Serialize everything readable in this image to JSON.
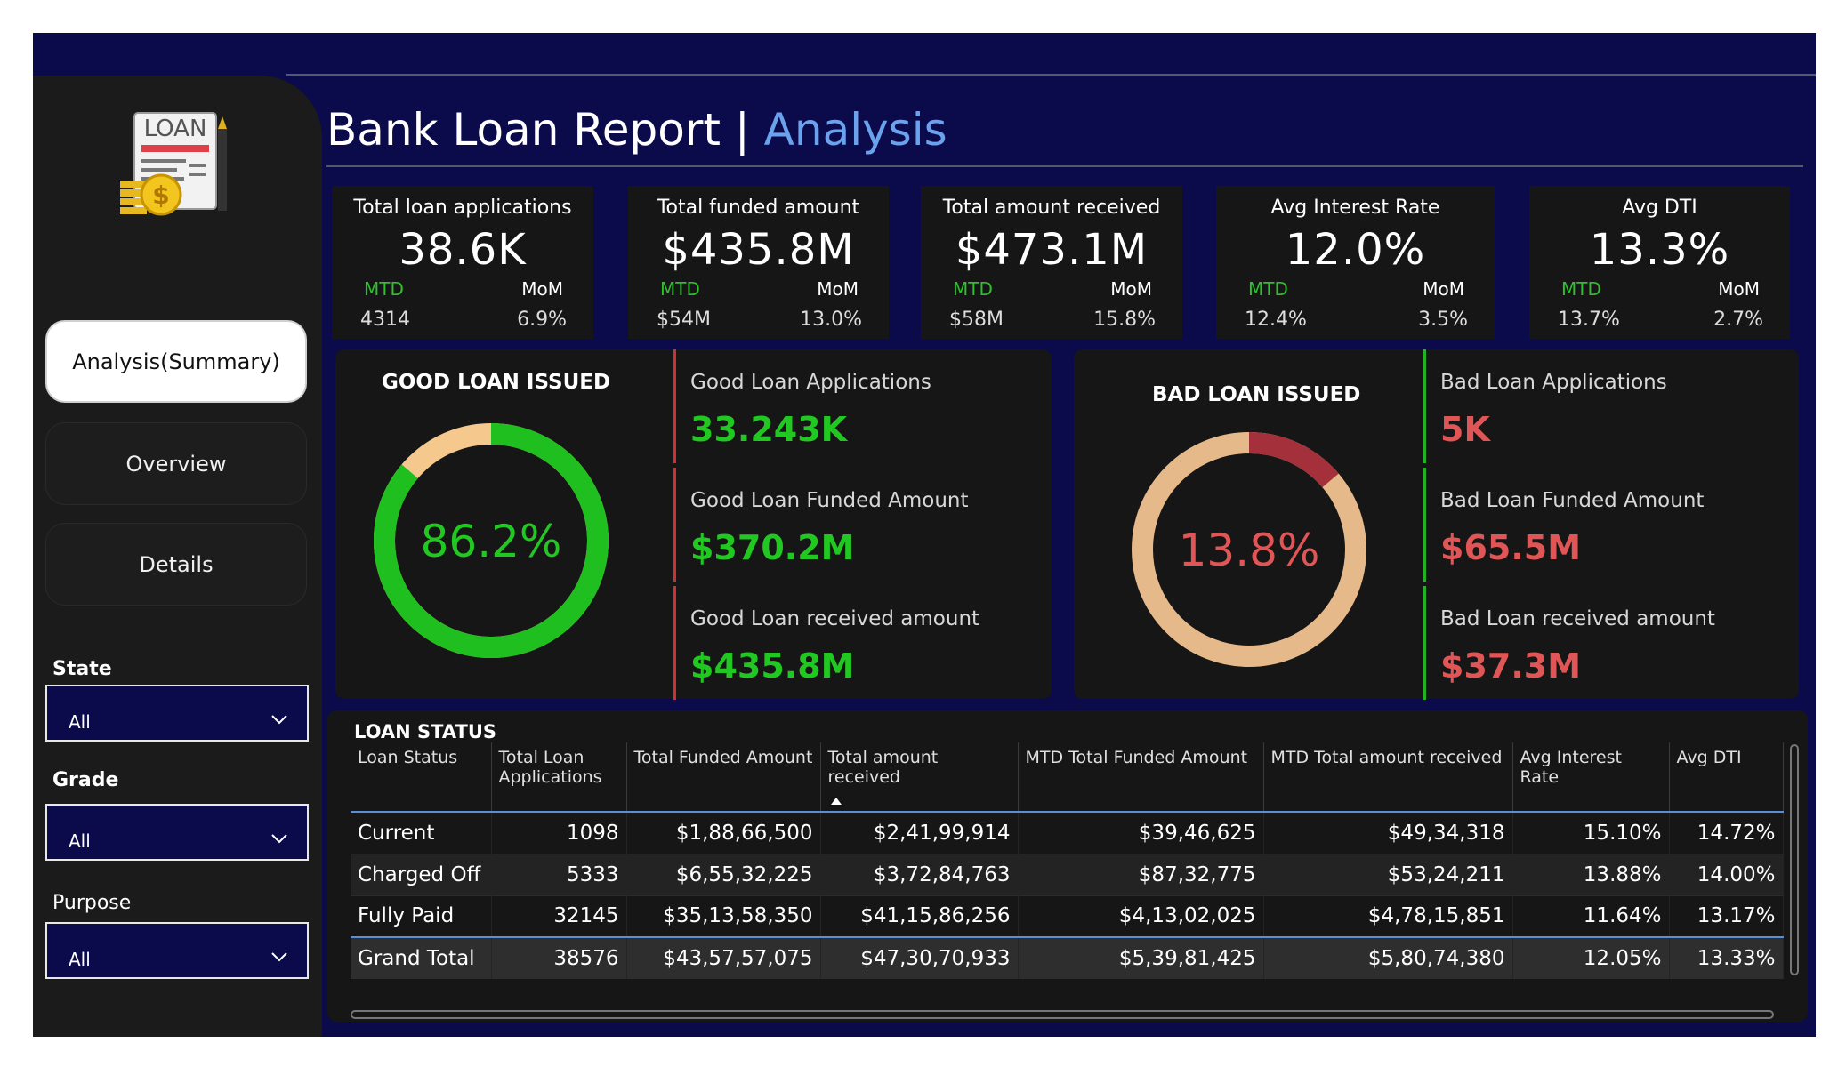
{
  "header": {
    "title_main": "Bank Loan Report",
    "title_sep": " | ",
    "title_accent": "Analysis",
    "logo_text": "LOAN"
  },
  "nav": {
    "summary": "Analysis(Summary)",
    "overview": "Overview",
    "details": "Details"
  },
  "filters": [
    {
      "label": "State",
      "value": "All"
    },
    {
      "label": "Grade",
      "value": "All"
    },
    {
      "label": "Purpose",
      "value": "All"
    }
  ],
  "kpis": [
    {
      "label": "Total loan applications",
      "value": "38.6K",
      "mtd_label": "MTD",
      "mom_label": "MoM",
      "mtd": "4314",
      "mom": "6.9%"
    },
    {
      "label": "Total funded amount",
      "value": "$435.8M",
      "mtd_label": "MTD",
      "mom_label": "MoM",
      "mtd": "$54M",
      "mom": "13.0%"
    },
    {
      "label": "Total amount received",
      "value": "$473.1M",
      "mtd_label": "MTD",
      "mom_label": "MoM",
      "mtd": "$58M",
      "mom": "15.8%"
    },
    {
      "label": "Avg Interest Rate",
      "value": "12.0%",
      "mtd_label": "MTD",
      "mom_label": "MoM",
      "mtd": "12.4%",
      "mom": "3.5%"
    },
    {
      "label": "Avg DTI",
      "value": "13.3%",
      "mtd_label": "MTD",
      "mom_label": "MoM",
      "mtd": "13.7%",
      "mom": "2.7%"
    }
  ],
  "good_loan": {
    "title": "GOOD LOAN ISSUED",
    "percent_label": "86.2%",
    "percent": 86.2,
    "colors": {
      "main": "#1fbf1f",
      "rest": "#f5c88e"
    },
    "stats": [
      {
        "label": "Good Loan Applications",
        "value": "33.243K"
      },
      {
        "label": "Good Loan Funded Amount",
        "value": "$370.2M"
      },
      {
        "label": "Good Loan received amount",
        "value": "$435.8M"
      }
    ]
  },
  "bad_loan": {
    "title": "BAD LOAN ISSUED",
    "percent_label": "13.8%",
    "percent": 13.8,
    "colors": {
      "main": "#a3303a",
      "rest": "#e6b98a"
    },
    "stats": [
      {
        "label": "Bad Loan Applications",
        "value": "5K"
      },
      {
        "label": "Bad Loan Funded Amount",
        "value": "$65.5M"
      },
      {
        "label": "Bad Loan received amount",
        "value": "$37.3M"
      }
    ]
  },
  "loan_status": {
    "title": "LOAN STATUS",
    "columns": [
      "Loan Status",
      "Total Loan Applications",
      "Total Funded Amount",
      "Total amount received",
      "MTD Total Funded Amount",
      "MTD Total amount received",
      "Avg Interest Rate",
      "Avg DTI"
    ],
    "rows": [
      [
        "Current",
        "1098",
        "$1,88,66,500",
        "$2,41,99,914",
        "$39,46,625",
        "$49,34,318",
        "15.10%",
        "14.72%"
      ],
      [
        "Charged Off",
        "5333",
        "$6,55,32,225",
        "$3,72,84,763",
        "$87,32,775",
        "$53,24,211",
        "13.88%",
        "14.00%"
      ],
      [
        "Fully Paid",
        "32145",
        "$35,13,58,350",
        "$41,15,86,256",
        "$4,13,02,025",
        "$4,78,15,851",
        "11.64%",
        "13.17%"
      ]
    ],
    "total": [
      "Grand Total",
      "38576",
      "$43,57,57,075",
      "$47,30,70,933",
      "$5,39,81,425",
      "$5,80,74,380",
      "12.05%",
      "13.33%"
    ]
  }
}
